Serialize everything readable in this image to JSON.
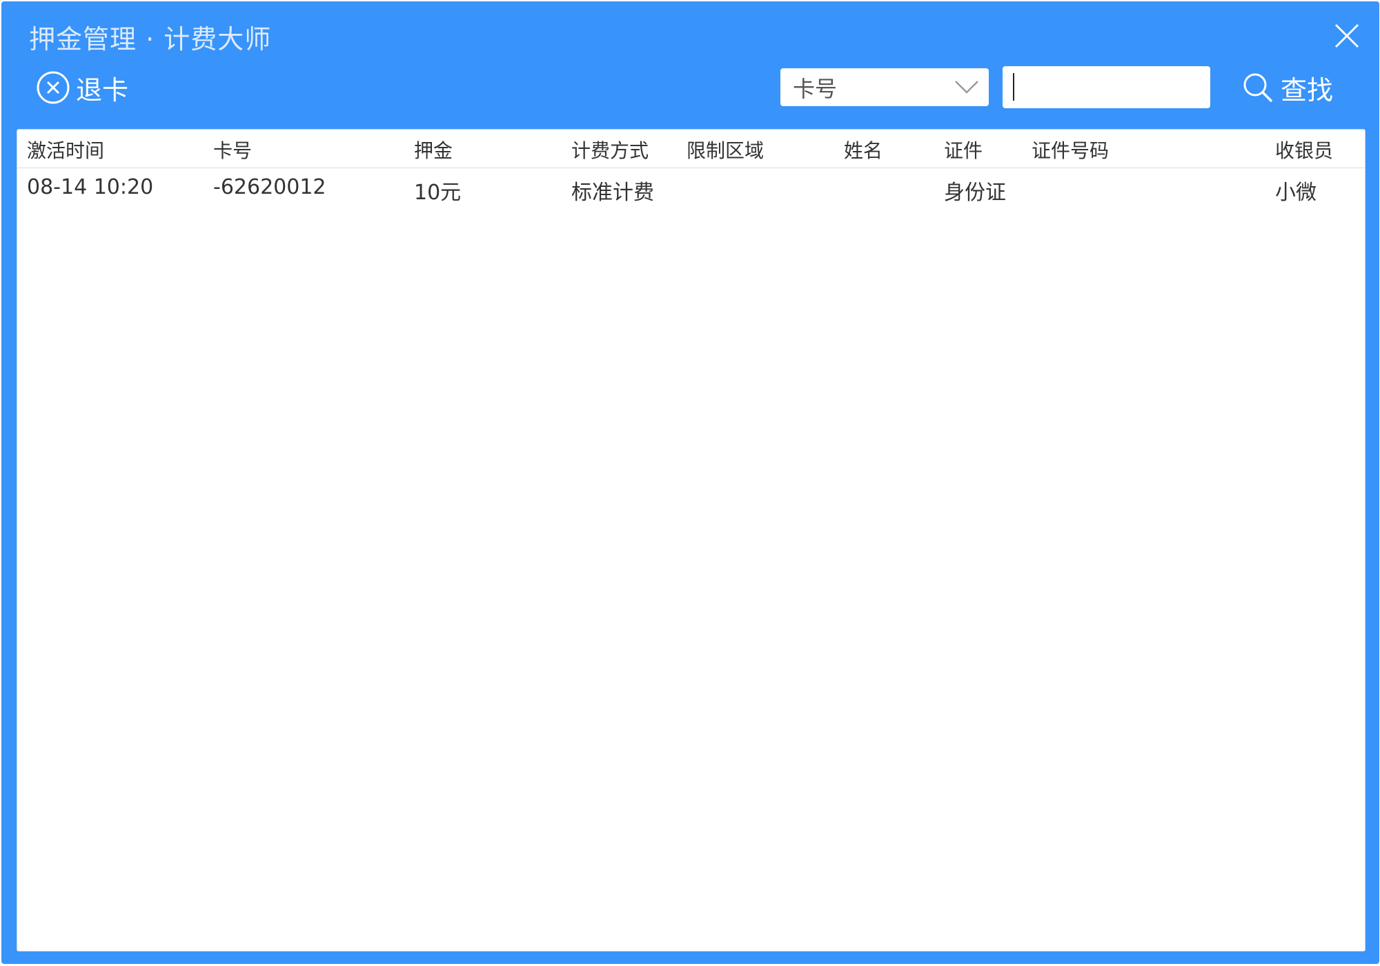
{
  "window": {
    "title": "押金管理 · 计费大师"
  },
  "toolbar": {
    "refund_label": "退卡",
    "filter_field": "卡号",
    "search_value": "",
    "find_label": "查找"
  },
  "table": {
    "columns": [
      "激活时间",
      "卡号",
      "押金",
      "计费方式",
      "限制区域",
      "姓名",
      "证件",
      "证件号码",
      "收银员"
    ],
    "rows": [
      [
        "08-14 10:20",
        "-62620012",
        "10元",
        "标准计费",
        "",
        "",
        "身份证",
        "",
        "小微"
      ]
    ]
  },
  "colors": {
    "window_blue": "#3893fa",
    "title_text": "#dbeafd",
    "cell_text": "#333333"
  },
  "icons": [
    "close-icon",
    "circle-x-icon",
    "chevron-down-icon",
    "search-icon"
  ]
}
